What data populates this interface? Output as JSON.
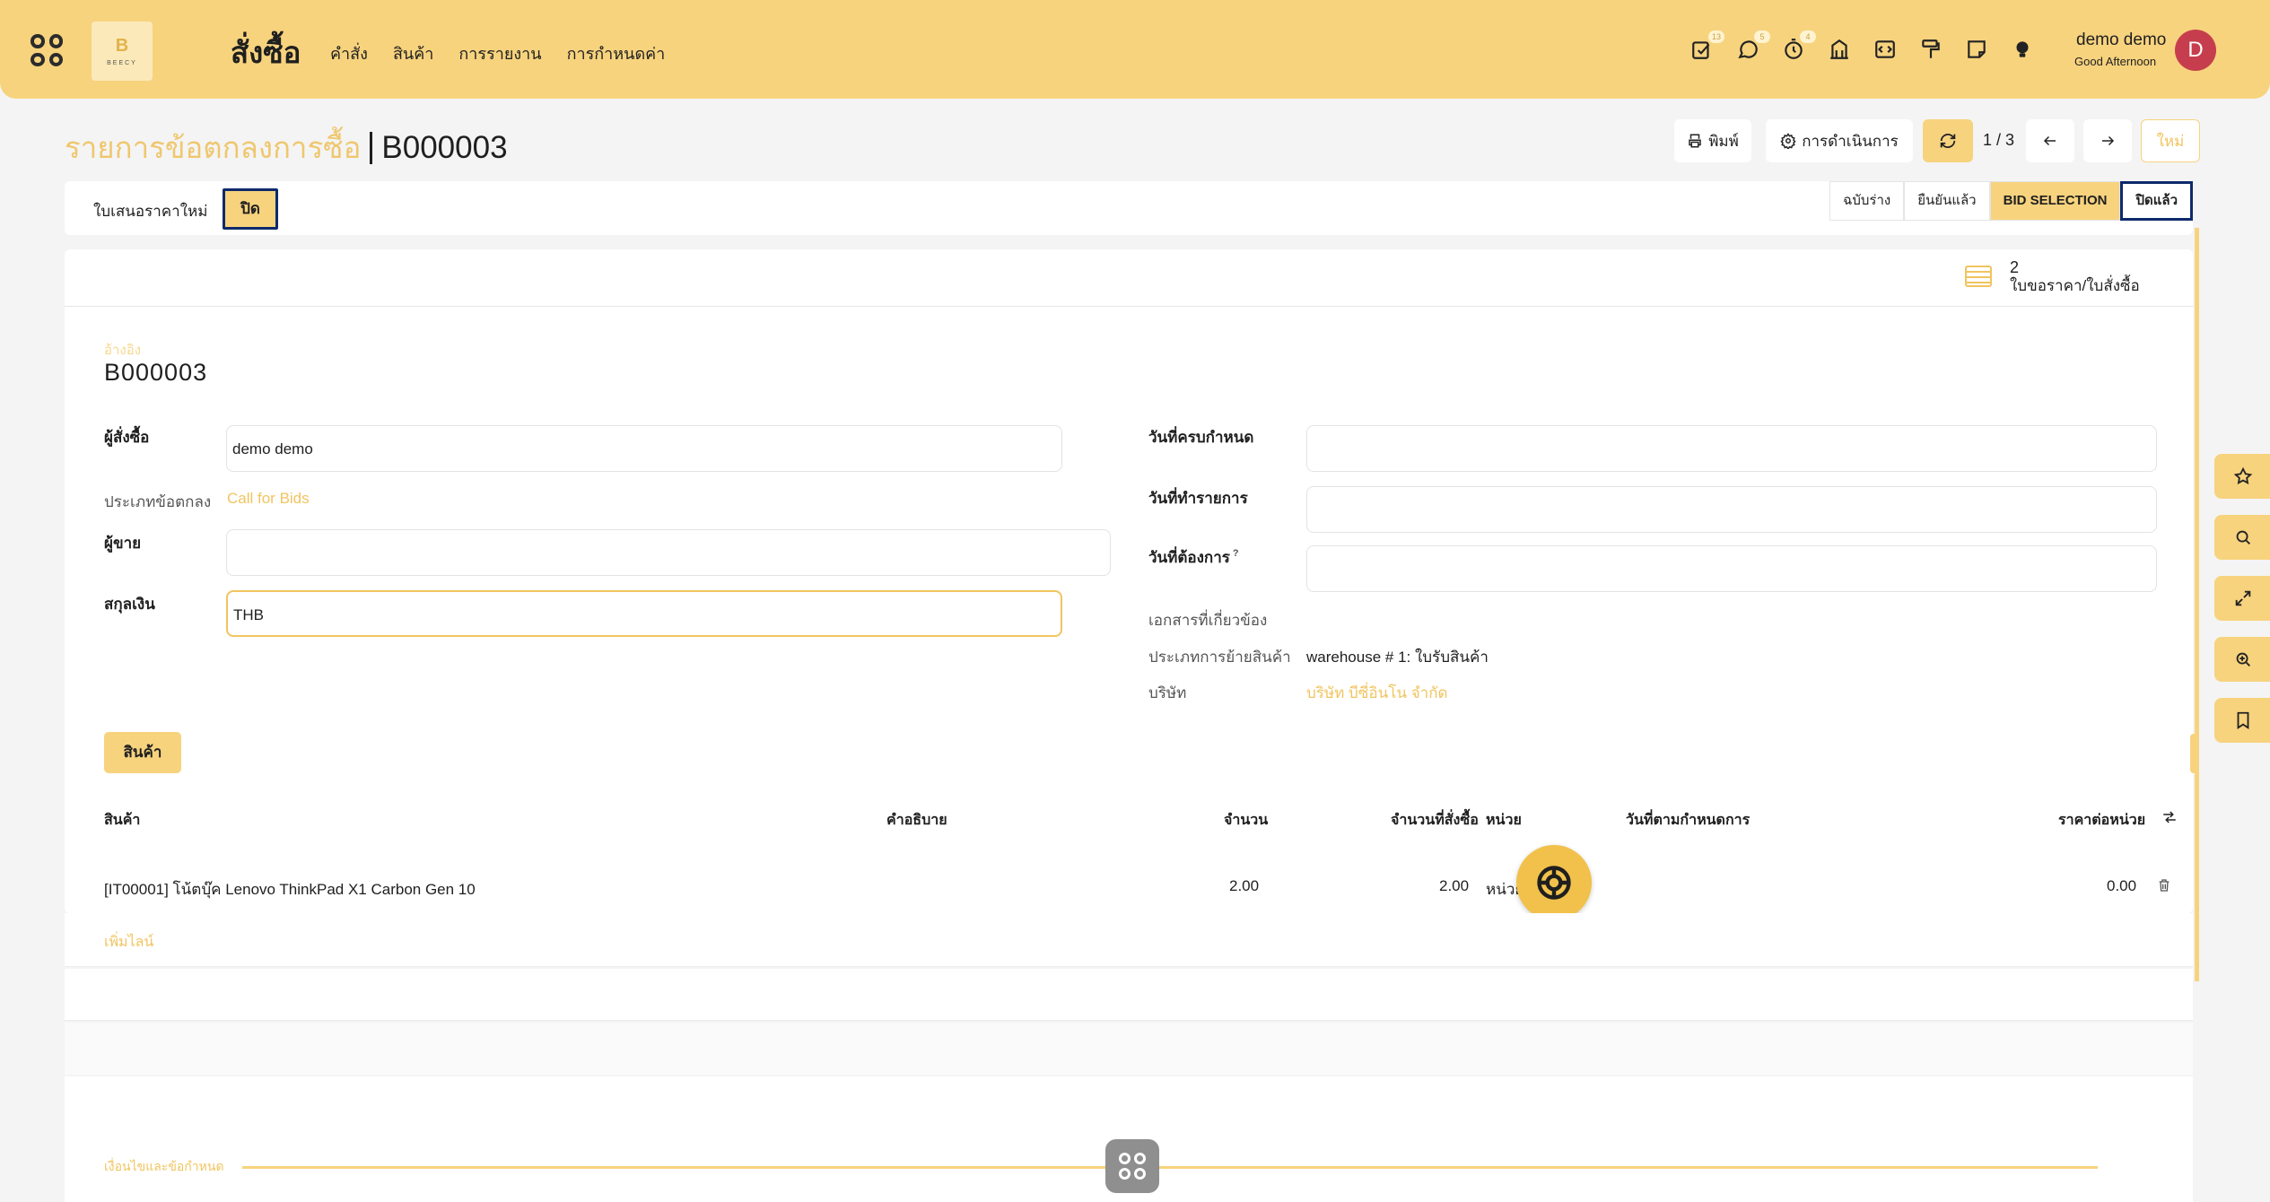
{
  "navbar": {
    "logo_letter": "B",
    "logo_text": "BEECY",
    "app_title": "สั่งซื้อ",
    "menu": [
      "คำสั่ง",
      "สินค้า",
      "การรายงาน",
      "การกำหนดค่า"
    ],
    "badges": {
      "activities": "13",
      "messages": "5",
      "timer": "4"
    },
    "user_name": "demo demo",
    "user_greeting": "Good Afternoon",
    "avatar_letter": "D"
  },
  "control_panel": {
    "breadcrumb_parent": "รายการข้อตกลงการซื้อ",
    "breadcrumb_current": "B000003",
    "print_label": "พิมพ์",
    "action_label": "การดำเนินการ",
    "pager_value": "1 / 3",
    "new_label": "ใหม่"
  },
  "statusbar": {
    "new_quotation": "ใบเสนอราคาใหม่",
    "close": "ปิด",
    "stages": [
      "ฉบับร่าง",
      "ยืนยันแล้ว",
      "BID SELECTION",
      "ปิดแล้ว"
    ],
    "active_stage": "BID SELECTION"
  },
  "smart_button": {
    "count": "2",
    "label": "ใบขอราคา/ใบสั่งซื้อ"
  },
  "form": {
    "reference_label": "อ้างอิง",
    "reference_value": "B000003",
    "buyer_label": "ผู้สั่งซื้อ",
    "buyer_value": "demo demo",
    "agreement_type_label": "ประเภทข้อตกลง",
    "agreement_type_value": "Call for Bids",
    "vendor_label": "ผู้ขาย",
    "vendor_value": "",
    "currency_label": "สกุลเงิน",
    "currency_value": "THB",
    "deadline_label": "วันที่ครบกำหนด",
    "deadline_value": "",
    "order_date_label": "วันที่ทำรายการ",
    "order_date_value": "",
    "delivery_date_label": "วันที่ต้องการ",
    "delivery_date_help": "?",
    "delivery_date_value": "",
    "source_doc_label": "เอกสารที่เกี่ยวข้อง",
    "picking_type_label": "ประเภทการย้ายสินค้า",
    "picking_type_value": "warehouse # 1: ใบรับสินค้า",
    "company_label": "บริษัท",
    "company_value": "บริษัท บีซี่อินโน จำกัด"
  },
  "products": {
    "tab_label": "สินค้า",
    "columns": [
      "สินค้า",
      "คำอธิบาย",
      "จำนวน",
      "จำนวนที่สั่งซื้อ",
      "หน่วย",
      "วันที่ตามกำหนดการ",
      "ราคาต่อหน่วย"
    ],
    "rows": [
      {
        "product": "[IT00001] โน้ตบุ๊ค Lenovo ThinkPad X1 Carbon Gen 10",
        "description": "",
        "qty": "2.00",
        "ordered_qty": "2.00",
        "uom": "หน่วย",
        "schedule_date": "",
        "price_unit": "0.00"
      }
    ],
    "add_line": "เพิ่มไลน์"
  },
  "terms": {
    "label": "เงื่อนไขและข้อกำหนด"
  },
  "colors": {
    "accent": "#f7d37e",
    "accent_strong": "#f1c45f",
    "avatar": "#c63e4d",
    "highlight_border": "#0d2a6b"
  }
}
